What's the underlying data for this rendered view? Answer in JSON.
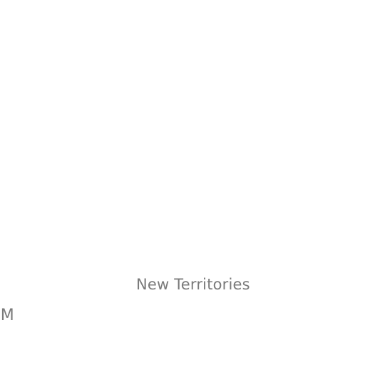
{
  "map": {
    "labels": {
      "region_new_territories": "New Territories",
      "region_partial_left": "IM"
    }
  },
  "colors": {
    "background": "#ffffff",
    "label_text": "#7a7a7a"
  }
}
